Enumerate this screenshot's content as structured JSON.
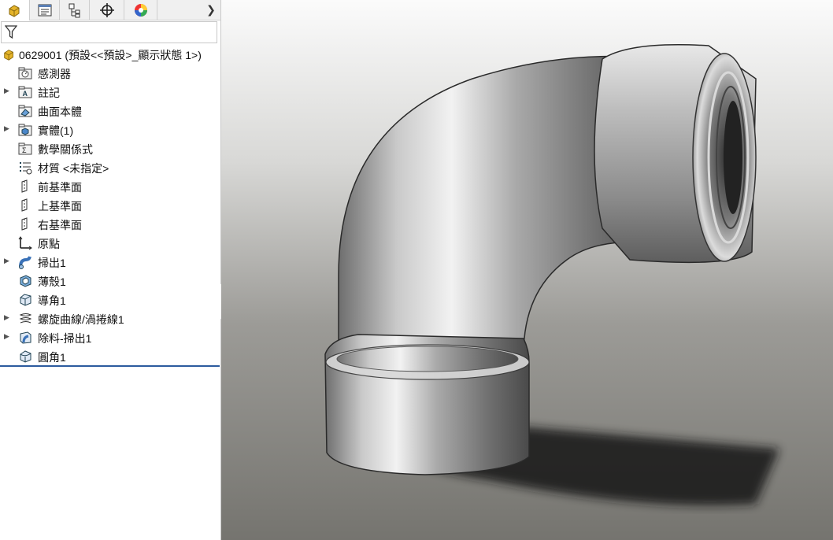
{
  "colors": {
    "accent_line": "#2c5b9e",
    "part_icon": "#e5b42a"
  },
  "tabs": [
    {
      "name": "feature-manager-tab-icon"
    },
    {
      "name": "property-manager-tab-icon"
    },
    {
      "name": "configuration-manager-tab-icon"
    },
    {
      "name": "dimxpert-manager-tab-icon"
    },
    {
      "name": "display-manager-tab-icon"
    }
  ],
  "filter_icon": "filter-icon",
  "root": {
    "label": "0629001  (預設<<預設>_顯示狀態 1>)",
    "icon": "part-icon"
  },
  "tree_items": [
    {
      "label": "感測器",
      "icon": "sensor-folder-icon",
      "expandable": false
    },
    {
      "label": "註記",
      "icon": "annotations-folder-icon",
      "expandable": true
    },
    {
      "label": "曲面本體",
      "icon": "surface-bodies-folder-icon",
      "expandable": false
    },
    {
      "label": "實體(1)",
      "icon": "solid-bodies-folder-icon",
      "expandable": true
    },
    {
      "label": "數學關係式",
      "icon": "equations-folder-icon",
      "expandable": false
    },
    {
      "label": "材質 <未指定>",
      "icon": "material-icon",
      "expandable": false
    },
    {
      "label": "前基準面",
      "icon": "plane-icon",
      "expandable": false
    },
    {
      "label": "上基準面",
      "icon": "plane-icon",
      "expandable": false
    },
    {
      "label": "右基準面",
      "icon": "plane-icon",
      "expandable": false
    },
    {
      "label": "原點",
      "icon": "origin-icon",
      "expandable": false
    },
    {
      "label": "掃出1",
      "icon": "sweep-icon",
      "expandable": true
    },
    {
      "label": "薄殼1",
      "icon": "shell-icon",
      "expandable": false
    },
    {
      "label": "導角1",
      "icon": "chamfer-icon",
      "expandable": false
    },
    {
      "label": "螺旋曲線/渦捲線1",
      "icon": "helix-icon",
      "expandable": true
    },
    {
      "label": "除料-掃出1",
      "icon": "cut-sweep-icon",
      "expandable": true
    },
    {
      "label": "圓角1",
      "icon": "fillet-icon",
      "expandable": false
    }
  ],
  "viewport": {
    "model": "pipe-elbow-model"
  }
}
